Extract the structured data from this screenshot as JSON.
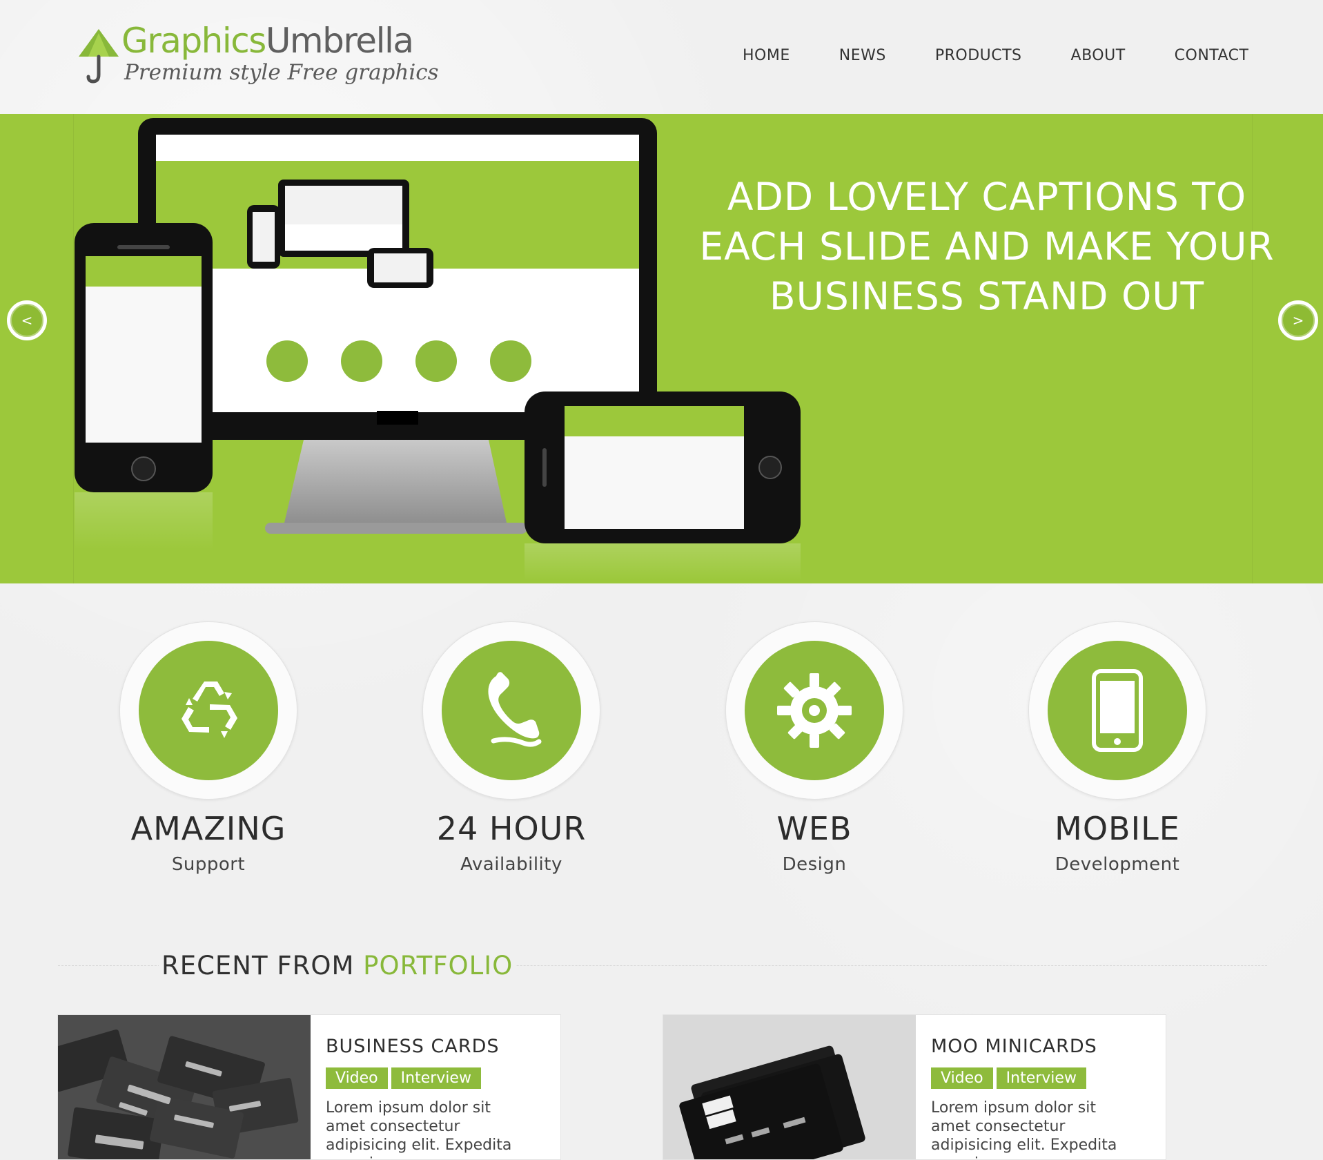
{
  "site": {
    "logo": {
      "title_left": "Graphics",
      "title_right": "Umbrella",
      "tagline": "Premium style Free graphics"
    },
    "nav": [
      "HOME",
      "NEWS",
      "PRODUCTS",
      "ABOUT",
      "CONTACT"
    ]
  },
  "hero": {
    "caption": "ADD LOVELY CAPTIONS TO EACH SLIDE AND MAKE YOUR BUSINESS STAND OUT",
    "prev_label": "<",
    "next_label": ">"
  },
  "features": [
    {
      "title": "AMAZING",
      "subtitle": "Support",
      "icon": "recycle-icon"
    },
    {
      "title": "24 HOUR",
      "subtitle": "Availability",
      "icon": "phone-icon"
    },
    {
      "title": "WEB",
      "subtitle": "Design",
      "icon": "gear-icon"
    },
    {
      "title": "MOBILE",
      "subtitle": "Development",
      "icon": "mobile-icon"
    }
  ],
  "portfolio": {
    "title_prefix": "RECENT FROM",
    "title_accent": "PORTFOLIO",
    "items": [
      {
        "title": "BUSINESS CARDS",
        "tags": [
          "Video",
          "Interview"
        ],
        "text": "Lorem ipsum dolor sit amet consectetur adipisicing elit. Expedita magni magnam"
      },
      {
        "title": "MOO MINICARDS",
        "tags": [
          "Video",
          "Interview"
        ],
        "text": "Lorem ipsum dolor sit amet consectetur adipisicing elit. Expedita magni magnam"
      }
    ]
  },
  "colors": {
    "accent": "#8ebb3c",
    "hero_bg": "#9cc83b",
    "page_bg": "#f0f0f0",
    "text_dark": "#2c2c2c"
  }
}
